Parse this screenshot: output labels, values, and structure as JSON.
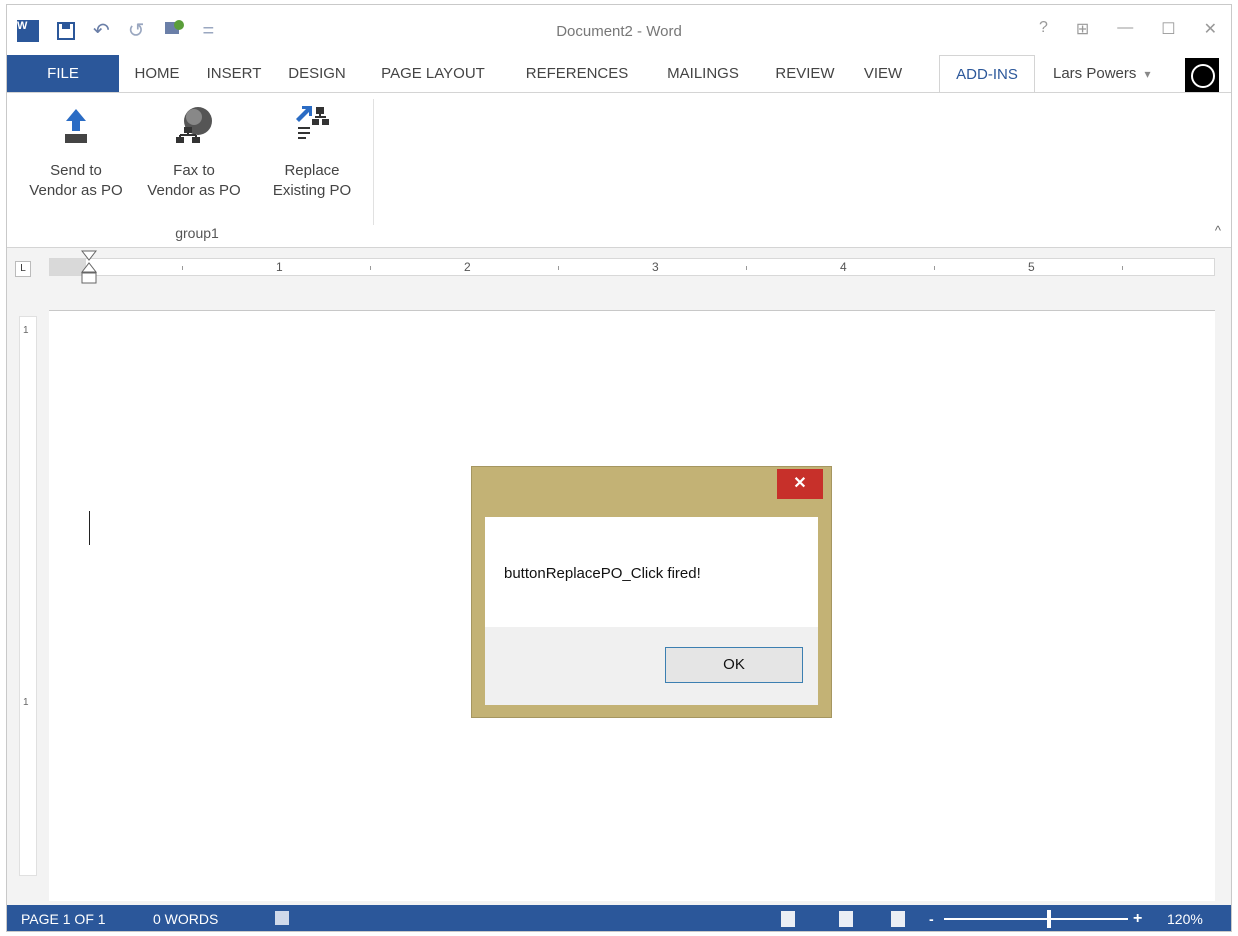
{
  "window": {
    "title": "Document2 - Word",
    "app_logo": "W",
    "controls": {
      "help": "?",
      "ribbon_options": "⊞",
      "minimize": "—",
      "maximize": "☐",
      "close": "✕"
    }
  },
  "quick_access": {
    "undo": "↶",
    "redo": "↺",
    "customize": "="
  },
  "ribbon": {
    "tabs": [
      "FILE",
      "HOME",
      "INSERT",
      "DESIGN",
      "PAGE LAYOUT",
      "REFERENCES",
      "MAILINGS",
      "REVIEW",
      "VIEW",
      "ADD-INS"
    ],
    "active_tab": "ADD-INS",
    "user": {
      "name": "Lars Powers",
      "caret": "▾"
    },
    "group": {
      "label": "group1",
      "buttons": [
        {
          "line1": "Send to",
          "line2": "Vendor as PO",
          "icon": "upload-arrow-icon"
        },
        {
          "line1": "Fax to",
          "line2": "Vendor as PO",
          "icon": "network-globe-icon"
        },
        {
          "line1": "Replace",
          "line2": "Existing PO",
          "icon": "org-chart-arrow-icon"
        }
      ]
    },
    "collapse": "^"
  },
  "ruler": {
    "corner": "L",
    "numbers": [
      "1",
      "2",
      "3",
      "4",
      "5"
    ]
  },
  "vertical_ruler": {
    "marks": [
      "1",
      "1"
    ]
  },
  "dialog": {
    "message": "buttonReplacePO_Click fired!",
    "ok_label": "OK",
    "close_label": "✕"
  },
  "status": {
    "page": "PAGE 1 OF 1",
    "words": "0 WORDS",
    "zoom_minus": "-",
    "zoom_plus": "+",
    "zoom": "120%"
  },
  "colors": {
    "accent": "#2b579a",
    "dialog_frame": "#c3b275",
    "dialog_close": "#c7302a"
  }
}
